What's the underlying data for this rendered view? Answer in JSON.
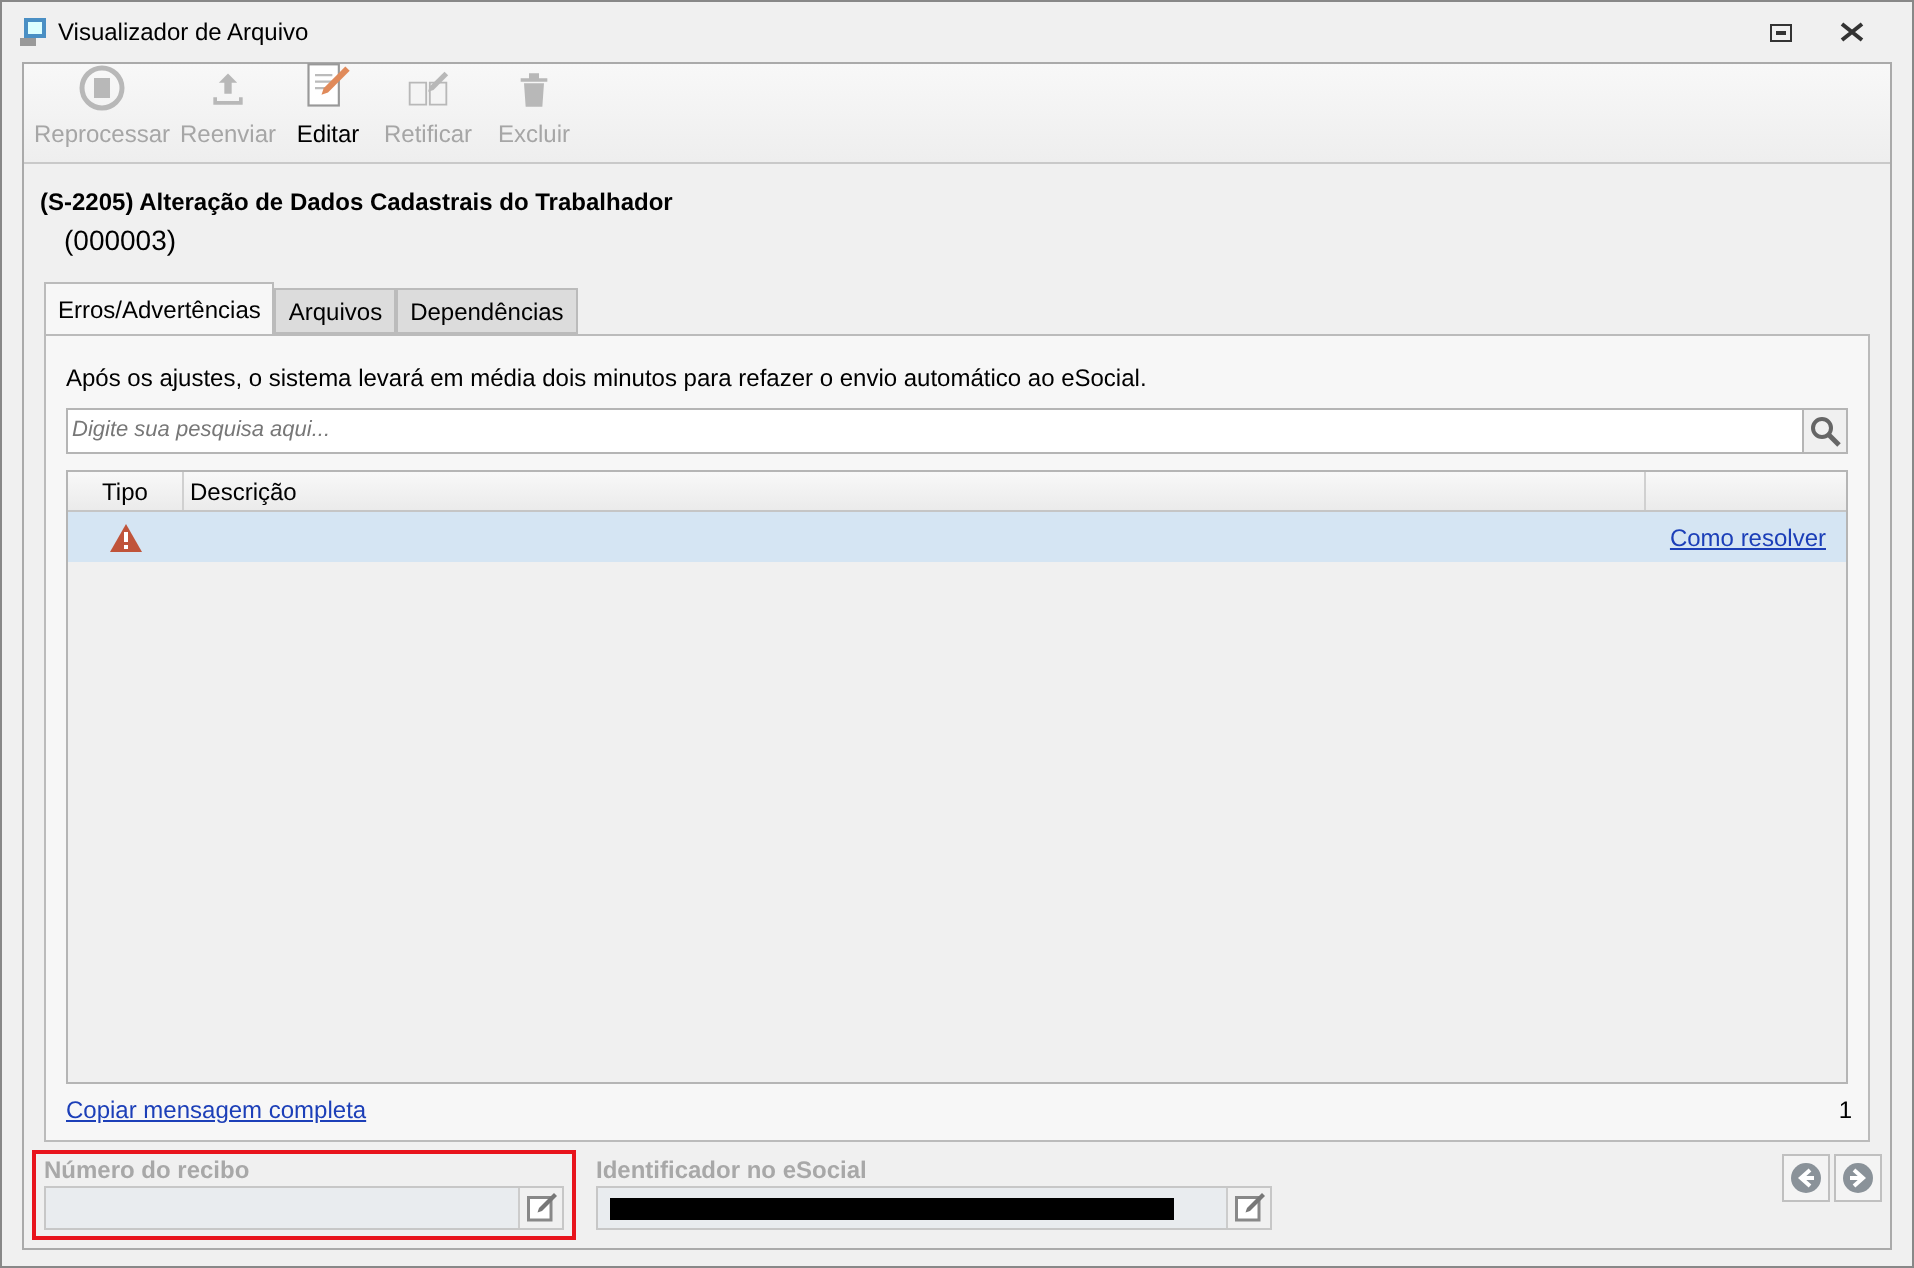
{
  "window": {
    "title": "Visualizador de Arquivo"
  },
  "toolbar": [
    {
      "kind": "reprocess",
      "label": "Reprocessar",
      "disabled": true
    },
    {
      "kind": "upload",
      "label": "Reenviar",
      "disabled": true
    },
    {
      "kind": "edit",
      "label": "Editar",
      "disabled": false
    },
    {
      "kind": "rectify",
      "label": "Retificar",
      "disabled": true
    },
    {
      "kind": "delete",
      "label": "Excluir",
      "disabled": true
    }
  ],
  "heading": {
    "title": "(S-2205) Alteração de Dados Cadastrais do Trabalhador",
    "code": "(000003)"
  },
  "tabs": [
    {
      "label": "Erros/Advertências",
      "selected": true
    },
    {
      "label": "Arquivos",
      "selected": false
    },
    {
      "label": "Dependências",
      "selected": false
    }
  ],
  "notice": "Após os ajustes, o sistema levará em média dois minutos para refazer o envio automático ao eSocial.",
  "search": {
    "placeholder": "Digite sua pesquisa aqui..."
  },
  "table": {
    "columns": [
      "Tipo",
      "Descrição"
    ],
    "rows": [
      {
        "kind": "warning",
        "link": "Como resolver",
        "selected": true
      }
    ]
  },
  "copy_link": "Copiar mensagem completa",
  "count": "1",
  "fields": [
    {
      "label": "Número do recibo",
      "redacted": false,
      "highlighted": true
    },
    {
      "label": "Identificador no eSocial",
      "redacted": true,
      "highlighted": false
    }
  ]
}
